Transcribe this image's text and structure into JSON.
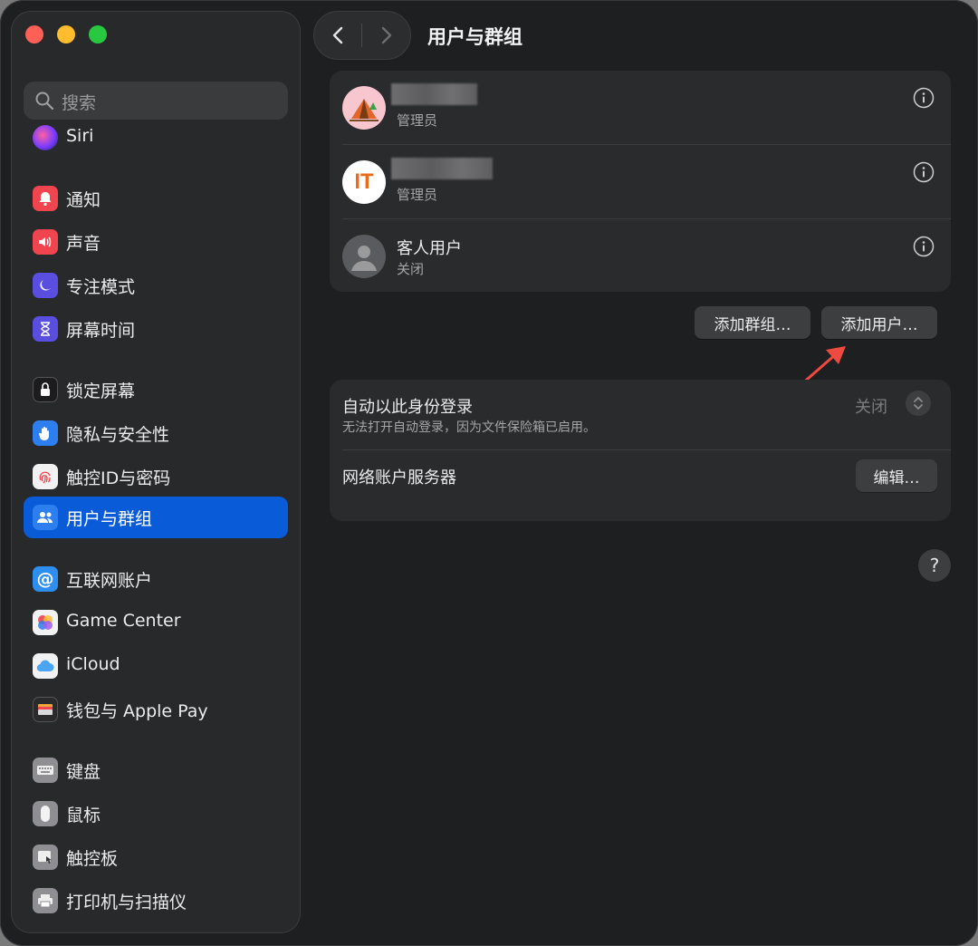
{
  "header": {
    "title": "用户与群组"
  },
  "search": {
    "placeholder": "搜索"
  },
  "sidebar": {
    "items": [
      {
        "label": "Siri",
        "icon": "siri-icon",
        "color": "#8a4bd9"
      },
      {
        "label": "通知",
        "icon": "bell-icon",
        "color": "#f0444e"
      },
      {
        "label": "声音",
        "icon": "speaker-icon",
        "color": "#f0444e"
      },
      {
        "label": "专注模式",
        "icon": "moon-icon",
        "color": "#5a4ee0"
      },
      {
        "label": "屏幕时间",
        "icon": "hourglass-icon",
        "color": "#5a4ee0"
      },
      {
        "label": "锁定屏幕",
        "icon": "lock-icon",
        "color": "#1c1c1e"
      },
      {
        "label": "隐私与安全性",
        "icon": "hand-icon",
        "color": "#2d7ff0"
      },
      {
        "label": "触控ID与密码",
        "icon": "fingerprint-icon",
        "color": "#f2f2f2"
      },
      {
        "label": "用户与群组",
        "icon": "users-icon",
        "color": "#2d7ff0"
      },
      {
        "label": "互联网账户",
        "icon": "at-icon",
        "color": "#2d8ef0"
      },
      {
        "label": "Game Center",
        "icon": "game-center-icon",
        "color": "#f2f2f2"
      },
      {
        "label": "iCloud",
        "icon": "cloud-icon",
        "color": "#f2f2f2"
      },
      {
        "label": "钱包与 Apple Pay",
        "icon": "wallet-icon",
        "color": "#2a2a2c"
      },
      {
        "label": "键盘",
        "icon": "keyboard-icon",
        "color": "#8e8e93"
      },
      {
        "label": "鼠标",
        "icon": "mouse-icon",
        "color": "#8e8e93"
      },
      {
        "label": "触控板",
        "icon": "trackpad-icon",
        "color": "#8e8e93"
      },
      {
        "label": "打印机与扫描仪",
        "icon": "printer-icon",
        "color": "#8e8e93"
      }
    ]
  },
  "users": [
    {
      "role": "管理员",
      "avatar": "camp-avatar-icon"
    },
    {
      "role": "管理员",
      "avatar": "it-avatar",
      "avatar_text": "IT"
    },
    {
      "name": "客人用户",
      "role": "关闭",
      "avatar": "guest-avatar-icon"
    }
  ],
  "buttons": {
    "add_group": "添加群组…",
    "add_user": "添加用户…",
    "edit": "编辑…"
  },
  "settings": {
    "auto_login_title": "自动以此身份登录",
    "auto_login_sub": "无法打开自动登录，因为文件保险箱已启用。",
    "auto_login_value": "关闭",
    "network_server": "网络账户服务器"
  },
  "help": "?",
  "accent": "#0a5bd7"
}
